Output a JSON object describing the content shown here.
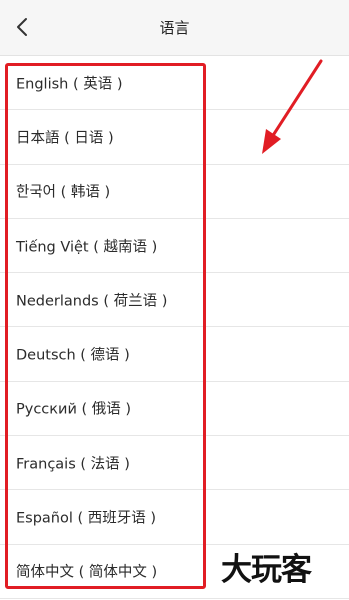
{
  "header": {
    "title": "语言",
    "back_icon": "chevron-left-icon"
  },
  "languages": [
    {
      "label": "English ( 英语 )"
    },
    {
      "label": "日本語 ( 日语 )"
    },
    {
      "label": "한국어 ( 韩语 )"
    },
    {
      "label": "Tiếng Việt ( 越南语 )"
    },
    {
      "label": "Nederlands ( 荷兰语 )"
    },
    {
      "label": "Deutsch ( 德语 )"
    },
    {
      "label": "Русский ( 俄语 )"
    },
    {
      "label": "Français ( 法语 )"
    },
    {
      "label": "Español ( 西班牙语 )"
    },
    {
      "label": "简体中文 ( 简体中文 )"
    }
  ],
  "annotations": {
    "highlight_color": "#e11d24",
    "arrow_color": "#e11d24"
  },
  "watermark": {
    "text": "大玩客"
  }
}
